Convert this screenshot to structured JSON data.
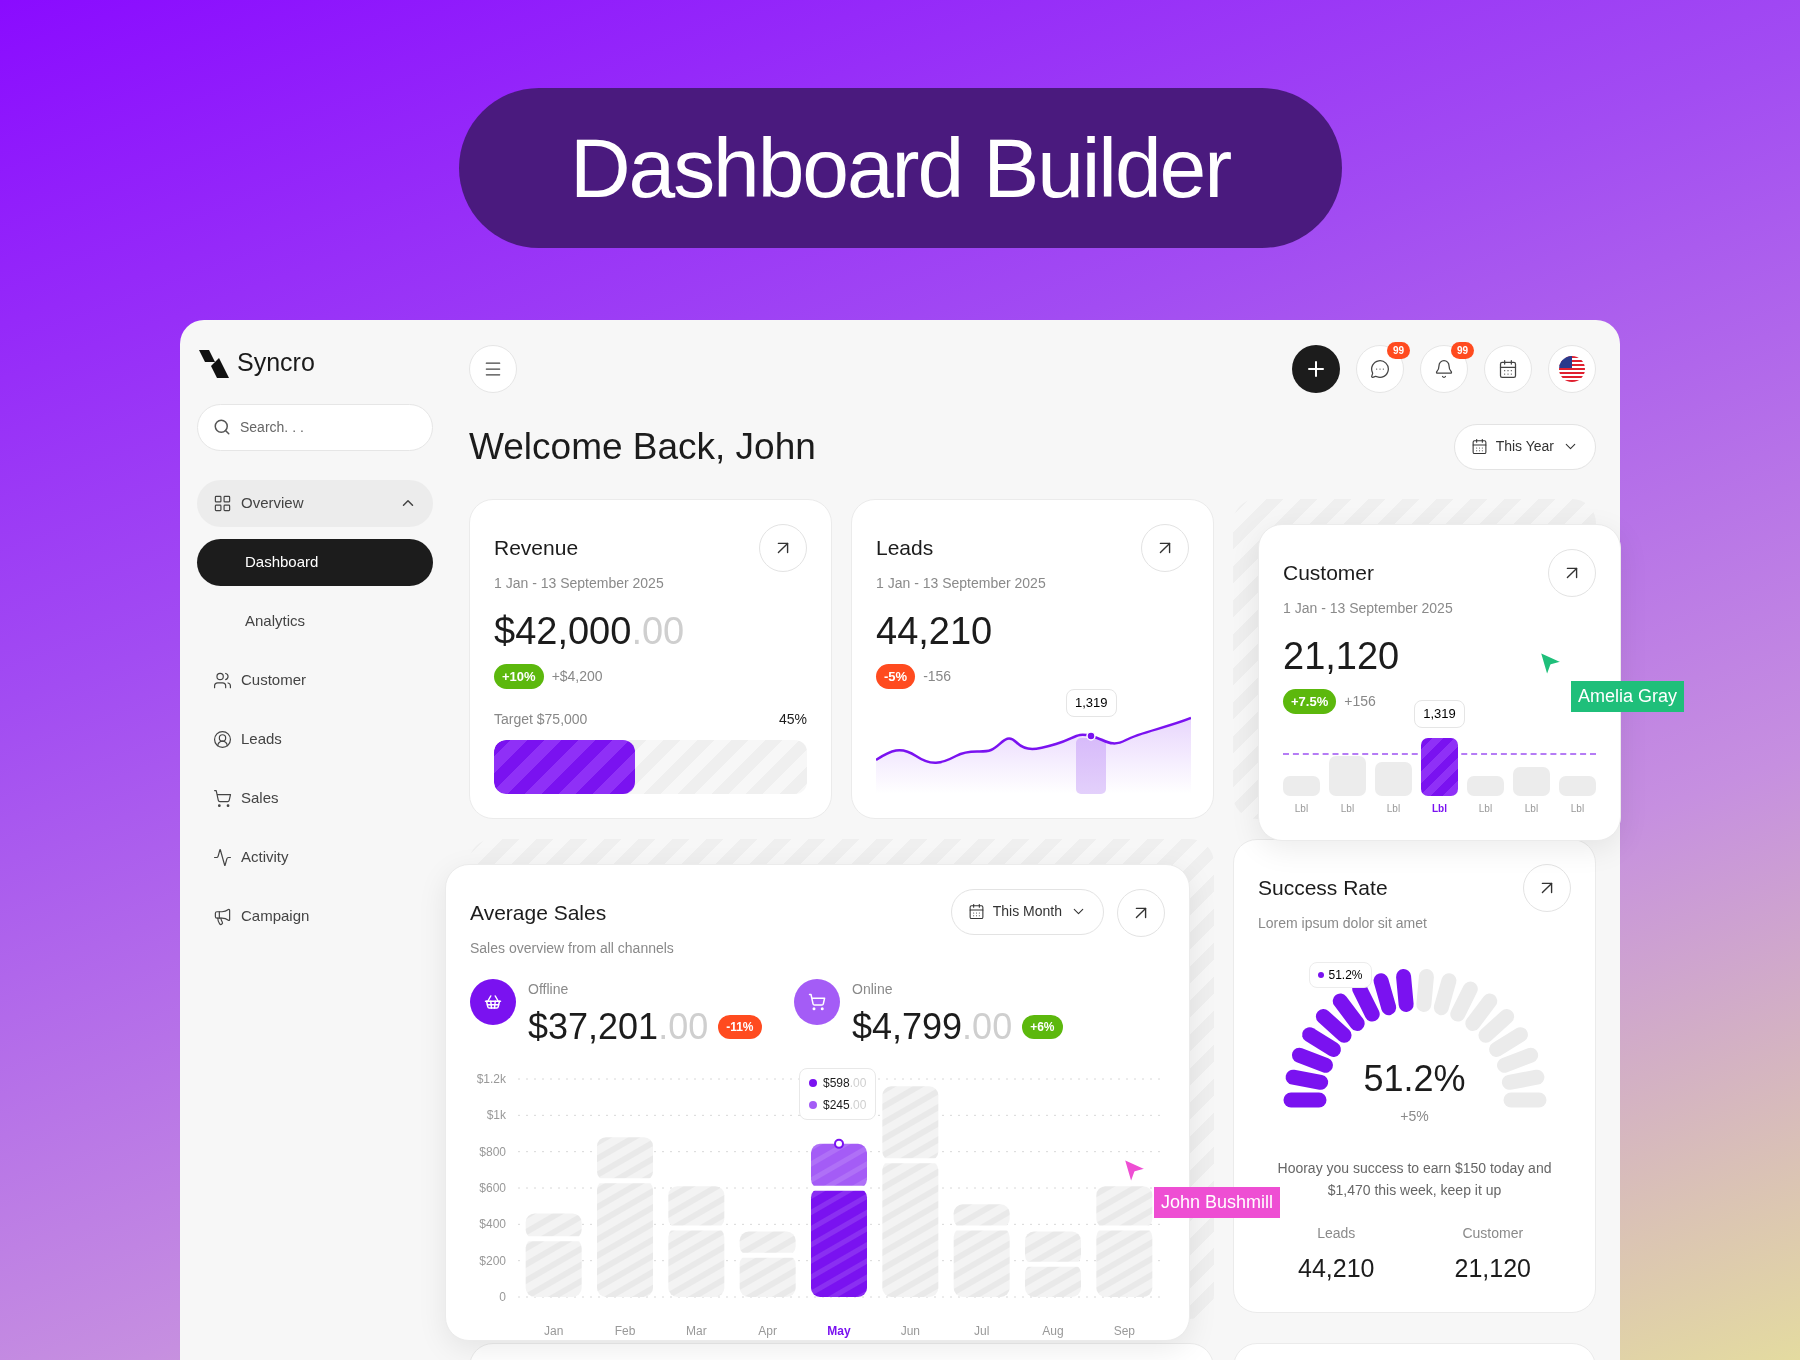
{
  "banner": {
    "title": "Dashboard Builder"
  },
  "brand": {
    "name": "Syncro"
  },
  "search": {
    "placeholder": "Search. . ."
  },
  "nav": [
    {
      "label": "Overview",
      "expanded": true,
      "selected": false,
      "children": [
        {
          "label": "Dashboard",
          "selected": true
        },
        {
          "label": "Analytics",
          "selected": false
        }
      ]
    },
    {
      "label": "Customer",
      "selected": false
    },
    {
      "label": "Leads",
      "selected": false
    },
    {
      "label": "Sales",
      "selected": false
    },
    {
      "label": "Activity",
      "selected": false
    },
    {
      "label": "Campaign",
      "selected": false
    }
  ],
  "header": {
    "notifications": [
      {
        "kind": "chat",
        "badge": "99"
      },
      {
        "kind": "bell",
        "badge": "99"
      }
    ]
  },
  "welcome": "Welcome Back, John",
  "period_select": {
    "value": "This Year"
  },
  "revenue": {
    "title": "Revenue",
    "date_range": "1 Jan - 13 September 2025",
    "amount": {
      "whole": "$42,000",
      "cents": ".00"
    },
    "change": {
      "badge": "+10%",
      "color": "#5cb80d",
      "delta": "+$4,200"
    },
    "target": "Target $75,000",
    "percent": "45%",
    "level": 0.45
  },
  "leads": {
    "title": "Leads",
    "date_range": "1 Jan - 13 September 2025",
    "value": "44,210",
    "change": {
      "badge": "-5%",
      "color": "#ff4b1f",
      "delta": "-156"
    },
    "tooltip": "1,319"
  },
  "customer": {
    "title": "Customer",
    "date_range": "1 Jan - 13 September 2025",
    "value": "21,120",
    "change": {
      "badge": "+7.5%",
      "color": "#5cb80d",
      "delta": "+156"
    },
    "tooltip": "1,319",
    "bars": [
      {
        "label": "Lbl",
        "selected": false
      },
      {
        "label": "Lbl",
        "selected": false
      },
      {
        "label": "Lbl",
        "selected": false
      },
      {
        "label": "Lbl",
        "selected": true
      },
      {
        "label": "Lbl",
        "selected": false
      },
      {
        "label": "Lbl",
        "selected": false
      },
      {
        "label": "Lbl",
        "selected": false
      }
    ]
  },
  "average_sales": {
    "title": "Average Sales",
    "subtitle": "Sales overview from all channels",
    "period_select": {
      "value": "This Month"
    },
    "channels": [
      {
        "kind": "offline",
        "label": "Offline",
        "amount": {
          "whole": "$37,201",
          "cents": ".00"
        },
        "change": {
          "badge": "-11%",
          "color": "#ff4b1f"
        }
      },
      {
        "kind": "online",
        "label": "Online",
        "amount": {
          "whole": "$4,799",
          "cents": ".00"
        },
        "change": {
          "badge": "+6%",
          "color": "#5cb80d"
        }
      }
    ],
    "months": [
      {
        "selected": false
      },
      {
        "selected": false
      },
      {
        "selected": false
      },
      {
        "selected": false
      },
      {
        "selected": true
      },
      {
        "selected": false
      },
      {
        "selected": false
      },
      {
        "selected": false
      },
      {
        "selected": false
      }
    ],
    "tooltip": [
      {
        "whole": "$598",
        "cents": ".00",
        "color": "#7a12f0"
      },
      {
        "whole": "$245",
        "cents": ".00",
        "color": "#a45cf6"
      }
    ],
    "chart_data": {
      "type": "bar",
      "stacked": true,
      "grid": true,
      "categories": [
        "Jan",
        "Feb",
        "Mar",
        "Apr",
        "May",
        "Jun",
        "Jul",
        "Aug",
        "Sep"
      ],
      "series": [
        {
          "values": [
            320,
            640,
            380,
            230,
            598,
            750,
            380,
            180,
            380
          ]
        },
        {
          "values": [
            140,
            240,
            230,
            130,
            245,
            410,
            130,
            180,
            230
          ]
        }
      ],
      "ylim": [
        0,
        1200
      ],
      "yticks": [
        {
          "value": 0,
          "label": "0"
        },
        {
          "value": 200,
          "label": "$200"
        },
        {
          "value": 400,
          "label": "$400"
        },
        {
          "value": 600,
          "label": "$600"
        },
        {
          "value": 800,
          "label": "$800"
        },
        {
          "value": 1000,
          "label": "$1k"
        },
        {
          "value": 1200,
          "label": "$1.2k"
        }
      ]
    }
  },
  "success_rate": {
    "title": "Success Rate",
    "subtitle": "Lorem ipsum dolor sit amet",
    "level": 0.512,
    "tooltip": "51.2%",
    "value": "51.2%",
    "change": "+5%",
    "message": "Hooray you success to earn $150 today and $1,470 this week, keep it up",
    "stats": [
      {
        "label": "Leads",
        "value": "44,210"
      },
      {
        "label": "Customer",
        "value": "21,120"
      }
    ]
  },
  "collaborators": [
    {
      "name": "Amelia Gray",
      "color": "#1fbf7a"
    },
    {
      "name": "John Bushmill",
      "color": "#ee4ed3"
    }
  ]
}
